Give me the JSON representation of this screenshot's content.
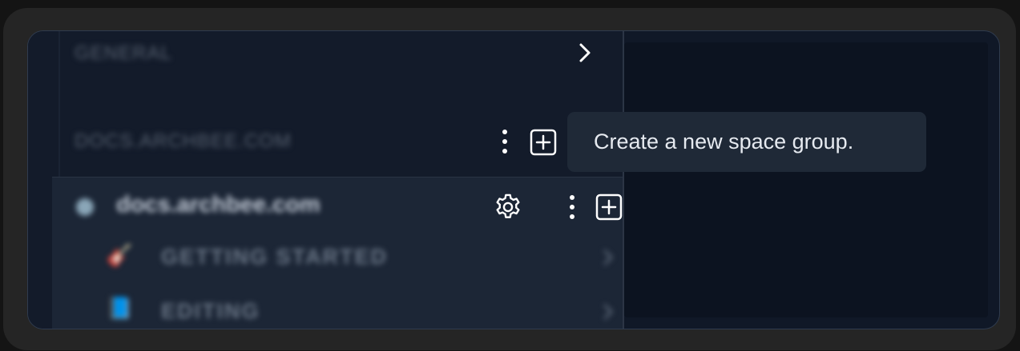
{
  "sidebar": {
    "sections": [
      {
        "label": "GENERAL"
      },
      {
        "label": "DOCS.ARCHBEE.COM"
      }
    ],
    "workspace": {
      "name": "docs.archbee.com",
      "items": [
        {
          "icon": "🎸",
          "label": "GETTING STARTED"
        },
        {
          "icon": "📘",
          "label": "EDITING"
        }
      ]
    }
  },
  "tooltip": {
    "text": "Create a new space group."
  },
  "icons": {
    "chevron": "chevron-right-icon",
    "more": "more-vertical-icon",
    "add": "plus-square-icon",
    "settings": "gear-icon"
  }
}
